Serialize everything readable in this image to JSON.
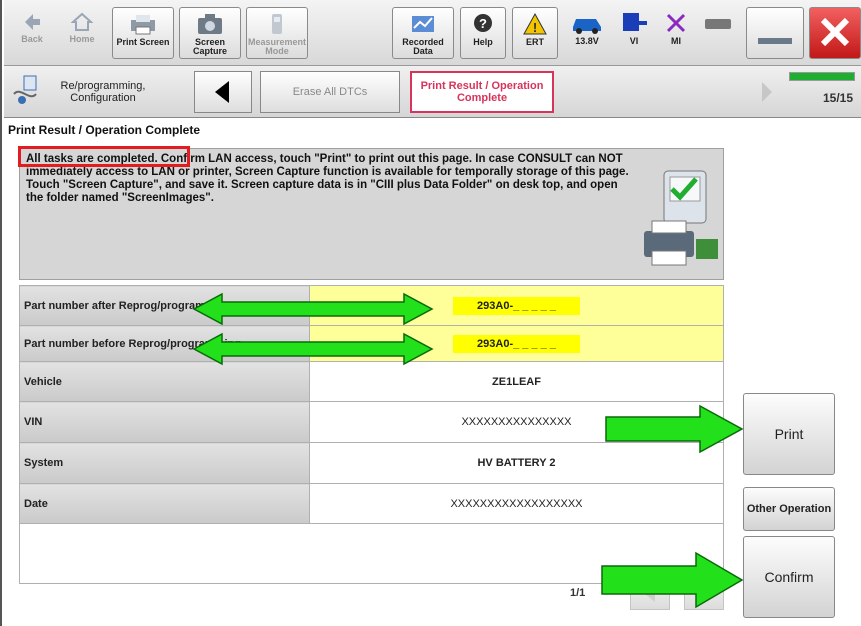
{
  "toolbar": {
    "back": "Back",
    "home": "Home",
    "print_screen": "Print Screen",
    "screen_capture": "Screen Capture",
    "measurement_mode": "Measurement Mode",
    "recorded_data": "Recorded Data",
    "help": "Help",
    "ert": "ERT",
    "voltage": "13.8V",
    "vi": "VI",
    "mi": "MI"
  },
  "nav": {
    "reprogramming": "Re/programming, Configuration",
    "erase_dtcs": "Erase All DTCs",
    "current_step": "Print Result / Operation Complete",
    "progress": "15/15",
    "progress_fraction": 1.0
  },
  "page_title": "Print Result / Operation Complete",
  "message": {
    "first_sentence": "All tasks are completed.",
    "rest": " Confirm LAN access, touch \"Print\" to print out this page. In case CONSULT can NOT immediately access to LAN or printer, Screen Capture function is available for temporally storage of this page. Touch \"Screen Capture\", and save it. Screen capture data is in \"CIII plus Data Folder\" on desk top, and open the folder named \"ScreenImages\"."
  },
  "table": {
    "rows": [
      {
        "label": "Part number after Reprog/programming",
        "value": "293A0-_ _ _ _ _"
      },
      {
        "label": "Part number before Reprog/programming",
        "value": "293A0-_ _ _ _ _"
      },
      {
        "label": "Vehicle",
        "value": "ZE1LEAF"
      },
      {
        "label": "VIN",
        "value": "XXXXXXXXXXXXXXX"
      },
      {
        "label": "System",
        "value": "HV BATTERY 2"
      },
      {
        "label": "Date",
        "value": "XXXXXXXXXXXXXXXXXX"
      }
    ]
  },
  "buttons": {
    "print": "Print",
    "other_operation": "Other Operation",
    "confirm": "Confirm"
  },
  "pager": {
    "text": "1/1"
  },
  "colors": {
    "highlight_yellow": "#ffff00",
    "row_yellow": "#ffff99",
    "arrow_green": "#22e01a",
    "callout_red": "#e21d22",
    "step_pink": "#d6345a"
  }
}
